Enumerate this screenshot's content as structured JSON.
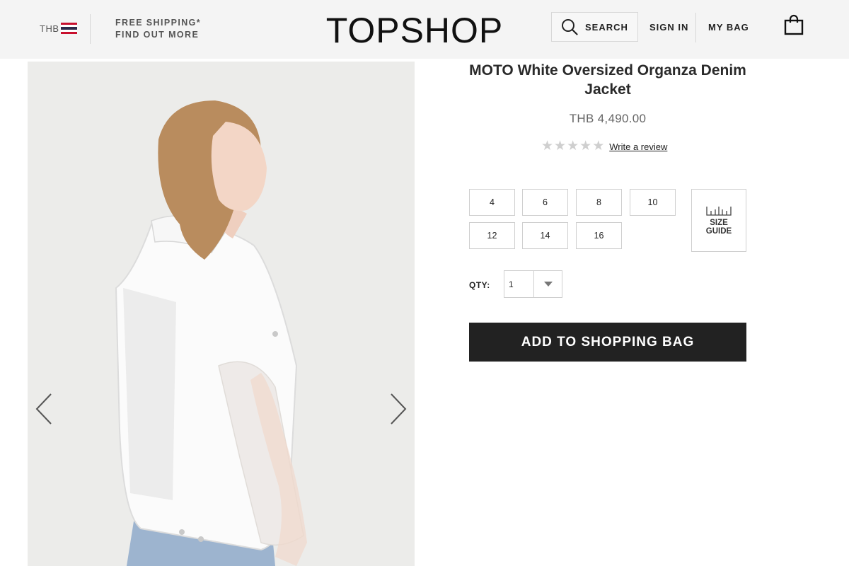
{
  "header": {
    "currency": "THB",
    "promo_line1": "FREE SHIPPING*",
    "promo_line2": "FIND OUT MORE",
    "logo": "TOPSHOP",
    "search_label": "SEARCH",
    "signin_label": "SIGN IN",
    "bag_label": "MY BAG"
  },
  "product": {
    "title": "MOTO White Oversized Organza Denim Jacket",
    "price": "THB 4,490.00",
    "rating": 0,
    "rating_max": 5,
    "review_link": "Write a review",
    "sizes": [
      "4",
      "6",
      "8",
      "10",
      "12",
      "14",
      "16"
    ],
    "size_guide_line1": "SIZE",
    "size_guide_line2": "GUIDE",
    "qty_label": "QTY:",
    "qty_value": "1",
    "add_button": "ADD TO SHOPPING BAG"
  },
  "colors": {
    "header_bg": "#f4f4f4",
    "button_bg": "#222222",
    "star_empty": "#cfcfcf"
  },
  "icons": [
    "thailand-flag-icon",
    "search-icon",
    "shopping-bag-icon",
    "chevron-left-icon",
    "chevron-right-icon",
    "star-icon",
    "ruler-icon",
    "caret-down-icon"
  ]
}
